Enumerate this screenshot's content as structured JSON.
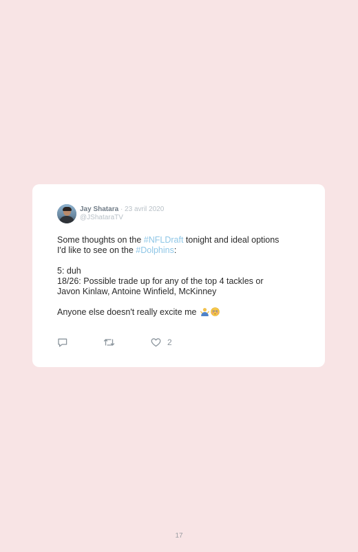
{
  "tweet": {
    "author_name": "Jay Shatara",
    "date": "· 23 avril 2020",
    "handle": "@JShataraTV",
    "text": {
      "l1_pre": "Some thoughts on the ",
      "l1_hashtag": "#NFLDraft",
      "l1_post": " tonight and ideal options",
      "l2_pre": "I'd like to see on the ",
      "l2_hashtag": "#Dolphins",
      "l2_post": ":",
      "l3": "5: duh",
      "l4": "18/26: Possible trade up for any of the top 4 tackles or",
      "l5": "Javon Kinlaw, Antoine Winfield, McKinney",
      "l6": "Anyone else doesn't really excite me "
    },
    "actions": {
      "like_count": "2"
    }
  },
  "footer": {
    "page_number": "17"
  },
  "colors": {
    "page_background": "#f8e4e5",
    "card_background": "#ffffff",
    "hashtag": "#8ec6e6",
    "muted": "#b8c0c7",
    "icon": "#8a949c"
  },
  "icons": {
    "reply": "reply-icon",
    "retweet": "retweet-icon",
    "like": "heart-icon",
    "emoji_1": "person-shrugging-emoji",
    "emoji_2": "flushed-face-emoji"
  }
}
